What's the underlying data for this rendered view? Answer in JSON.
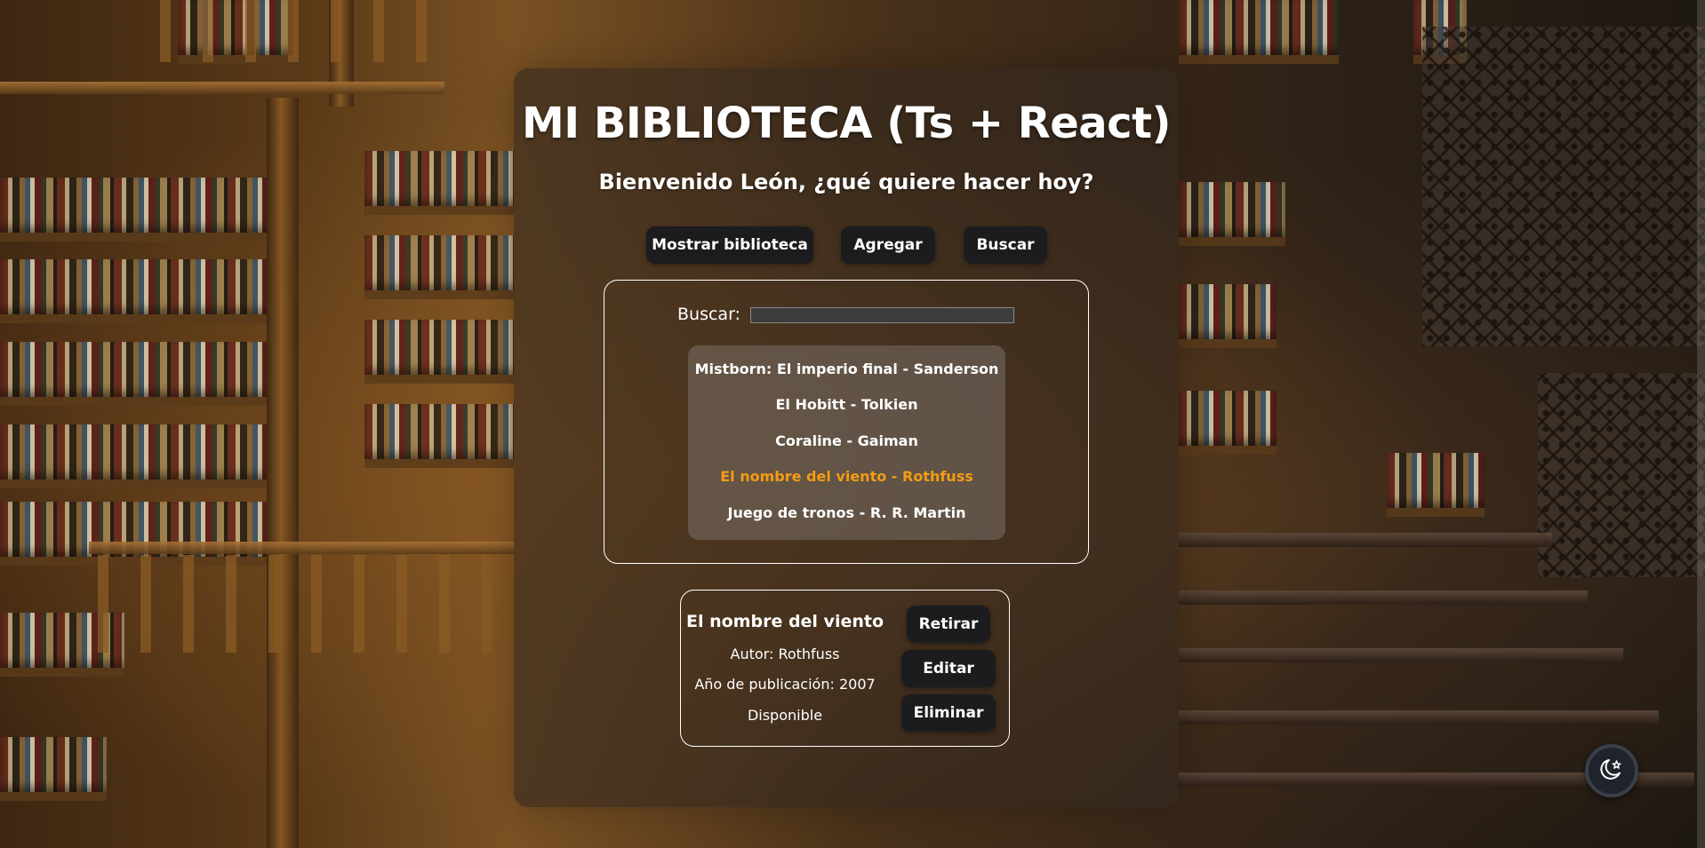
{
  "header": {
    "title": "MI BIBLIOTECA (Ts + React)",
    "welcome": "Bienvenido León, ¿qué quiere hacer hoy?"
  },
  "nav": {
    "show_library": "Mostrar biblioteca",
    "add": "Agregar",
    "search": "Buscar"
  },
  "search": {
    "label": "Buscar:",
    "value": "",
    "results": [
      {
        "text": "Mistborn: El imperio final - Sanderson",
        "selected": false
      },
      {
        "text": "El Hobitt - Tolkien",
        "selected": false
      },
      {
        "text": "Coraline - Gaiman",
        "selected": false
      },
      {
        "text": "El nombre del viento - Rothfuss",
        "selected": true
      },
      {
        "text": "Juego de tronos - R. R. Martin",
        "selected": false
      }
    ]
  },
  "detail": {
    "title": "El nombre del viento",
    "author": "Autor: Rothfuss",
    "year": "Año de publicación: 2007",
    "status": "Disponible",
    "actions": {
      "withdraw": "Retirar",
      "edit": "Editar",
      "delete": "Eliminar"
    }
  },
  "theme_toggle": {
    "icon": "moon-star-icon"
  },
  "colors": {
    "selected_result": "#f39c12",
    "button_bg": "#1c1c1e",
    "text": "#ffffff"
  }
}
